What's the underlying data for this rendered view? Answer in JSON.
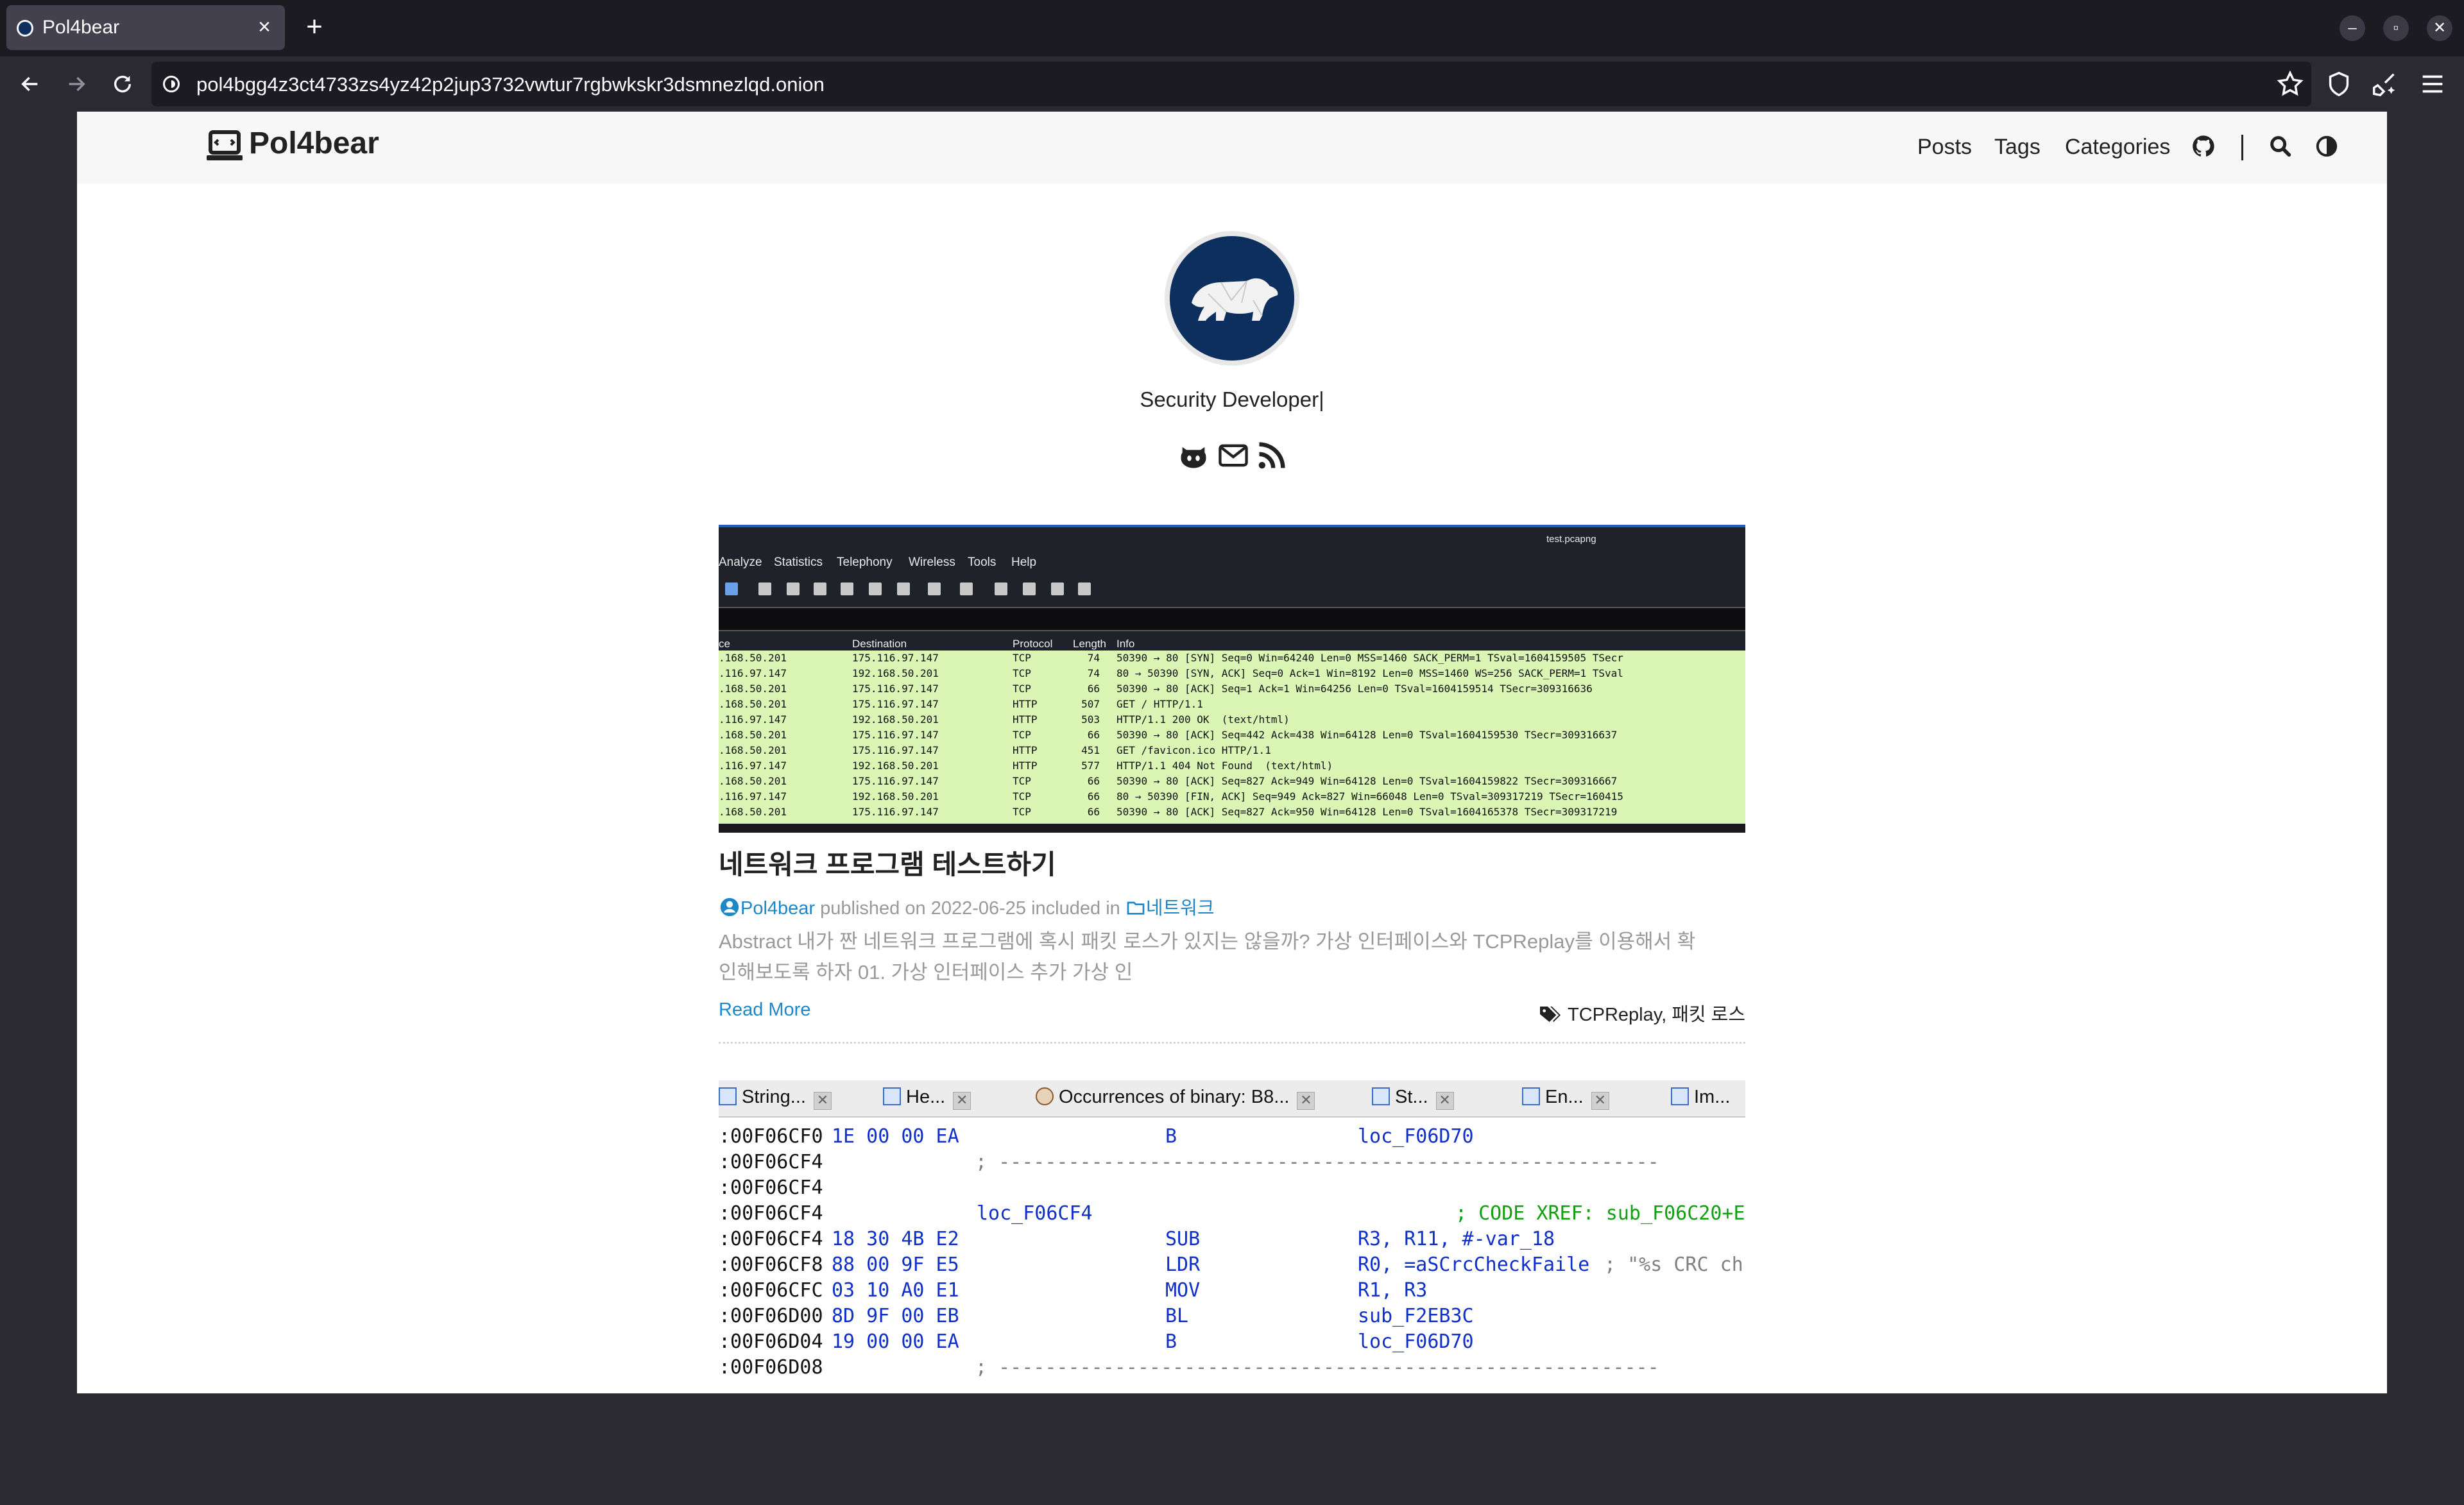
{
  "browser": {
    "tab_title": "Pol4bear",
    "tab_close": "×",
    "new_tab": "+",
    "url": "pol4bgg4z3ct4733zs4yz42p2jup3732vwtur7rgbwkskr3dsmnezlqd.onion",
    "window_controls": {
      "minimize": "–",
      "restore": "▫",
      "close": "✕"
    }
  },
  "site": {
    "title": "Pol4bear",
    "nav": [
      "Posts",
      "Tags",
      "Categories"
    ],
    "subtitle": "Security Developer|"
  },
  "posts": [
    {
      "title": "네트워크 프로그램 테스트하기",
      "author": "Pol4bear",
      "published_prefix": "published on",
      "date": "2022-06-25",
      "included_prefix": "included in",
      "category": "네트워크",
      "summary_line1": "Abstract 내가 짠 네트워크 프로그램에 혹시 패킷 로스가 있지는 않을까? 가상 인터페이스와 TCPReplay를 이용해서 확",
      "summary_line2": "인해보도록 하자 01. 가상 인터페이스 추가 가상 인",
      "read_more": "Read More",
      "tags": "TCPReplay, 패킷 로스"
    }
  ],
  "wireshark_thumb": {
    "window_title": "test.pcapng",
    "menu": [
      "Analyze",
      "Statistics",
      "Telephony",
      "Wireless",
      "Tools",
      "Help"
    ],
    "columns": [
      "ce",
      "Destination",
      "Protocol",
      "Length",
      "Info"
    ],
    "rows": [
      [
        ".168.50.201",
        "175.116.97.147",
        "TCP",
        "74",
        "50390 → 80 [SYN] Seq=0 Win=64240 Len=0 MSS=1460 SACK_PERM=1 TSval=1604159505 TSecr"
      ],
      [
        ".116.97.147",
        "192.168.50.201",
        "TCP",
        "74",
        "80 → 50390 [SYN, ACK] Seq=0 Ack=1 Win=8192 Len=0 MSS=1460 WS=256 SACK_PERM=1 TSval"
      ],
      [
        ".168.50.201",
        "175.116.97.147",
        "TCP",
        "66",
        "50390 → 80 [ACK] Seq=1 Ack=1 Win=64256 Len=0 TSval=1604159514 TSecr=309316636"
      ],
      [
        ".168.50.201",
        "175.116.97.147",
        "HTTP",
        "507",
        "GET / HTTP/1.1"
      ],
      [
        ".116.97.147",
        "192.168.50.201",
        "HTTP",
        "503",
        "HTTP/1.1 200 OK  (text/html)"
      ],
      [
        ".168.50.201",
        "175.116.97.147",
        "TCP",
        "66",
        "50390 → 80 [ACK] Seq=442 Ack=438 Win=64128 Len=0 TSval=1604159530 TSecr=309316637"
      ],
      [
        ".168.50.201",
        "175.116.97.147",
        "HTTP",
        "451",
        "GET /favicon.ico HTTP/1.1"
      ],
      [
        ".116.97.147",
        "192.168.50.201",
        "HTTP",
        "577",
        "HTTP/1.1 404 Not Found  (text/html)"
      ],
      [
        ".168.50.201",
        "175.116.97.147",
        "TCP",
        "66",
        "50390 → 80 [ACK] Seq=827 Ack=949 Win=64128 Len=0 TSval=1604159822 TSecr=309316667"
      ],
      [
        ".116.97.147",
        "192.168.50.201",
        "TCP",
        "66",
        "80 → 50390 [FIN, ACK] Seq=949 Ack=827 Win=66048 Len=0 TSval=309317219 TSecr=160415"
      ],
      [
        ".168.50.201",
        "175.116.97.147",
        "TCP",
        "66",
        "50390 → 80 [ACK] Seq=827 Ack=950 Win=64128 Len=0 TSval=1604165378 TSecr=309317219"
      ]
    ]
  },
  "ida_thumb": {
    "tabs": [
      "String...",
      "He...",
      "Occurrences of binary: B8...",
      "St...",
      "En...",
      "Im..."
    ],
    "tab_close": "✕",
    "lines": [
      {
        "addr": ":00F06CF0",
        "bytes": "1E 00 00 EA",
        "label": "",
        "mn": "B",
        "op": "loc_F06D70",
        "cmt": ""
      },
      {
        "addr": ":00F06CF4",
        "bytes": "",
        "label": "",
        "mn": "",
        "op": "",
        "cmt": "; ---------------------------------------------------------"
      },
      {
        "addr": ":00F06CF4",
        "bytes": "",
        "label": "",
        "mn": "",
        "op": "",
        "cmt": ""
      },
      {
        "addr": ":00F06CF4",
        "bytes": "",
        "label": "loc_F06CF4",
        "mn": "",
        "op": "",
        "cmt": "; CODE XREF: sub_F06C20+E"
      },
      {
        "addr": ":00F06CF4",
        "bytes": "18 30 4B E2",
        "label": "",
        "mn": "SUB",
        "op": "R3, R11, #-var_18",
        "cmt": ""
      },
      {
        "addr": ":00F06CF8",
        "bytes": "88 00 9F E5",
        "label": "",
        "mn": "LDR",
        "op": "R0, =aSCrcCheckFaile",
        "cmt": "; \"%s CRC ch"
      },
      {
        "addr": ":00F06CFC",
        "bytes": "03 10 A0 E1",
        "label": "",
        "mn": "MOV",
        "op": "R1, R3",
        "cmt": ""
      },
      {
        "addr": ":00F06D00",
        "bytes": "8D 9F 00 EB",
        "label": "",
        "mn": "BL",
        "op": "sub_F2EB3C",
        "cmt": ""
      },
      {
        "addr": ":00F06D04",
        "bytes": "19 00 00 EA",
        "label": "",
        "mn": "B",
        "op": "loc_F06D70",
        "cmt": ""
      },
      {
        "addr": ":00F06D08",
        "bytes": "",
        "label": "",
        "mn": "",
        "op": "",
        "cmt": "; ---------------------------------------------------------"
      }
    ]
  },
  "icons": {
    "back": "arrow-left-icon",
    "forward": "arrow-right-icon",
    "reload": "reload-icon",
    "bookmark": "star-icon",
    "shield": "shield-icon",
    "extension": "broom-icon",
    "menu": "hamburger-icon",
    "github": "github-icon",
    "search": "search-icon",
    "theme": "theme-toggle-icon",
    "mail": "mail-icon",
    "rss": "rss-icon",
    "author": "user-circle-icon",
    "category": "folder-icon",
    "tags": "tags-icon"
  },
  "colors": {
    "accent": "#1d87c8",
    "avatar_bg": "#0d2f5e",
    "browser_bg": "#2b2a33",
    "tabbar_bg": "#1c1b22",
    "ws_rows": "#daf5b4"
  }
}
